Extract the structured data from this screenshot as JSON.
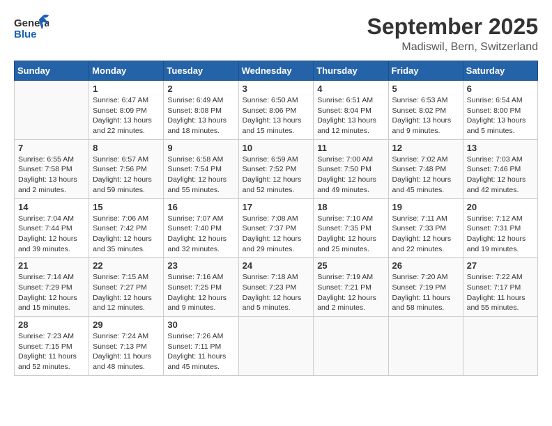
{
  "header": {
    "logo_line1": "General",
    "logo_line2": "Blue",
    "month": "September 2025",
    "location": "Madiswil, Bern, Switzerland"
  },
  "days_of_week": [
    "Sunday",
    "Monday",
    "Tuesday",
    "Wednesday",
    "Thursday",
    "Friday",
    "Saturday"
  ],
  "weeks": [
    [
      {
        "day": "",
        "info": ""
      },
      {
        "day": "1",
        "info": "Sunrise: 6:47 AM\nSunset: 8:09 PM\nDaylight: 13 hours\nand 22 minutes."
      },
      {
        "day": "2",
        "info": "Sunrise: 6:49 AM\nSunset: 8:08 PM\nDaylight: 13 hours\nand 18 minutes."
      },
      {
        "day": "3",
        "info": "Sunrise: 6:50 AM\nSunset: 8:06 PM\nDaylight: 13 hours\nand 15 minutes."
      },
      {
        "day": "4",
        "info": "Sunrise: 6:51 AM\nSunset: 8:04 PM\nDaylight: 13 hours\nand 12 minutes."
      },
      {
        "day": "5",
        "info": "Sunrise: 6:53 AM\nSunset: 8:02 PM\nDaylight: 13 hours\nand 9 minutes."
      },
      {
        "day": "6",
        "info": "Sunrise: 6:54 AM\nSunset: 8:00 PM\nDaylight: 13 hours\nand 5 minutes."
      }
    ],
    [
      {
        "day": "7",
        "info": "Sunrise: 6:55 AM\nSunset: 7:58 PM\nDaylight: 13 hours\nand 2 minutes."
      },
      {
        "day": "8",
        "info": "Sunrise: 6:57 AM\nSunset: 7:56 PM\nDaylight: 12 hours\nand 59 minutes."
      },
      {
        "day": "9",
        "info": "Sunrise: 6:58 AM\nSunset: 7:54 PM\nDaylight: 12 hours\nand 55 minutes."
      },
      {
        "day": "10",
        "info": "Sunrise: 6:59 AM\nSunset: 7:52 PM\nDaylight: 12 hours\nand 52 minutes."
      },
      {
        "day": "11",
        "info": "Sunrise: 7:00 AM\nSunset: 7:50 PM\nDaylight: 12 hours\nand 49 minutes."
      },
      {
        "day": "12",
        "info": "Sunrise: 7:02 AM\nSunset: 7:48 PM\nDaylight: 12 hours\nand 45 minutes."
      },
      {
        "day": "13",
        "info": "Sunrise: 7:03 AM\nSunset: 7:46 PM\nDaylight: 12 hours\nand 42 minutes."
      }
    ],
    [
      {
        "day": "14",
        "info": "Sunrise: 7:04 AM\nSunset: 7:44 PM\nDaylight: 12 hours\nand 39 minutes."
      },
      {
        "day": "15",
        "info": "Sunrise: 7:06 AM\nSunset: 7:42 PM\nDaylight: 12 hours\nand 35 minutes."
      },
      {
        "day": "16",
        "info": "Sunrise: 7:07 AM\nSunset: 7:40 PM\nDaylight: 12 hours\nand 32 minutes."
      },
      {
        "day": "17",
        "info": "Sunrise: 7:08 AM\nSunset: 7:37 PM\nDaylight: 12 hours\nand 29 minutes."
      },
      {
        "day": "18",
        "info": "Sunrise: 7:10 AM\nSunset: 7:35 PM\nDaylight: 12 hours\nand 25 minutes."
      },
      {
        "day": "19",
        "info": "Sunrise: 7:11 AM\nSunset: 7:33 PM\nDaylight: 12 hours\nand 22 minutes."
      },
      {
        "day": "20",
        "info": "Sunrise: 7:12 AM\nSunset: 7:31 PM\nDaylight: 12 hours\nand 19 minutes."
      }
    ],
    [
      {
        "day": "21",
        "info": "Sunrise: 7:14 AM\nSunset: 7:29 PM\nDaylight: 12 hours\nand 15 minutes."
      },
      {
        "day": "22",
        "info": "Sunrise: 7:15 AM\nSunset: 7:27 PM\nDaylight: 12 hours\nand 12 minutes."
      },
      {
        "day": "23",
        "info": "Sunrise: 7:16 AM\nSunset: 7:25 PM\nDaylight: 12 hours\nand 9 minutes."
      },
      {
        "day": "24",
        "info": "Sunrise: 7:18 AM\nSunset: 7:23 PM\nDaylight: 12 hours\nand 5 minutes."
      },
      {
        "day": "25",
        "info": "Sunrise: 7:19 AM\nSunset: 7:21 PM\nDaylight: 12 hours\nand 2 minutes."
      },
      {
        "day": "26",
        "info": "Sunrise: 7:20 AM\nSunset: 7:19 PM\nDaylight: 11 hours\nand 58 minutes."
      },
      {
        "day": "27",
        "info": "Sunrise: 7:22 AM\nSunset: 7:17 PM\nDaylight: 11 hours\nand 55 minutes."
      }
    ],
    [
      {
        "day": "28",
        "info": "Sunrise: 7:23 AM\nSunset: 7:15 PM\nDaylight: 11 hours\nand 52 minutes."
      },
      {
        "day": "29",
        "info": "Sunrise: 7:24 AM\nSunset: 7:13 PM\nDaylight: 11 hours\nand 48 minutes."
      },
      {
        "day": "30",
        "info": "Sunrise: 7:26 AM\nSunset: 7:11 PM\nDaylight: 11 hours\nand 45 minutes."
      },
      {
        "day": "",
        "info": ""
      },
      {
        "day": "",
        "info": ""
      },
      {
        "day": "",
        "info": ""
      },
      {
        "day": "",
        "info": ""
      }
    ]
  ]
}
